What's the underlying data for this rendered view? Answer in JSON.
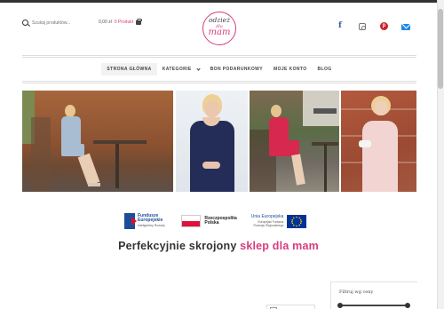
{
  "header": {
    "search": {
      "placeholder": "Szukaj produktów..."
    },
    "cart": {
      "price": "0,00 zł",
      "count": "0 Produkt"
    },
    "logo": {
      "line1": "odzież",
      "line2": "dla",
      "line3": "mam"
    },
    "social": [
      {
        "icon": "facebook-icon",
        "glyph": "f"
      },
      {
        "icon": "instagram-icon",
        "glyph": ""
      },
      {
        "icon": "pinterest-icon",
        "glyph": "p"
      },
      {
        "icon": "mail-icon",
        "glyph": ""
      }
    ]
  },
  "nav": {
    "items": [
      {
        "label": "STRONA GŁÓWNA",
        "active": true
      },
      {
        "label": "KATEGORIE",
        "dropdown": true
      },
      {
        "label": "BON PODARUNKOWY"
      },
      {
        "label": "MOJE KONTO"
      },
      {
        "label": "BLOG"
      }
    ]
  },
  "gallery": {
    "photos": [
      "photo-light-blue-dress",
      "photo-navy-dress",
      "photo-pink-dress",
      "photo-lace-dress"
    ]
  },
  "funding": {
    "eu_funds": {
      "line1": "Fundusze",
      "line2": "Europejskie",
      "sub": "Inteligentny Rozwój"
    },
    "poland": {
      "line1": "Rzeczpospolita",
      "line2": "Polska"
    },
    "eu": {
      "title": "Unia Europejska",
      "sub1": "Europejski Fundusz",
      "sub2": "Rozwoju Regionalnego"
    }
  },
  "headline": {
    "text": "Perfekcyjnie skrojony ",
    "accent": "sklep dla mam"
  },
  "filter": {
    "title": "Filtruj wg ceny"
  },
  "colors": {
    "accent": "#d63d7c",
    "facebook": "#3b5998",
    "pinterest": "#cb2027",
    "mail": "#1e88e5",
    "eu_blue": "#003399"
  }
}
